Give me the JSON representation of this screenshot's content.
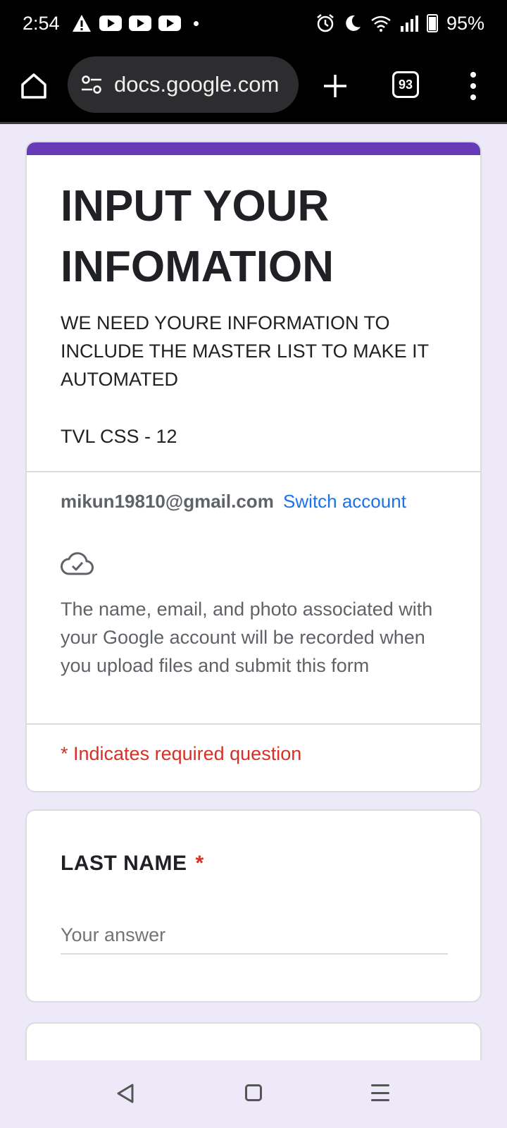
{
  "status_bar": {
    "time": "2:54",
    "battery": "95%"
  },
  "browser": {
    "url": "docs.google.com",
    "tab_count": "93"
  },
  "form": {
    "title": "INPUT YOUR INFOMATION",
    "description": "WE NEED YOURE INFORMATION TO INCLUDE THE MASTER LIST TO MAKE IT AUTOMATED",
    "section": "TVL CSS  - 12",
    "account_email": "mikun19810@gmail.com",
    "switch_account": "Switch account",
    "privacy_notice": "The name, email, and photo associated with your Google account will be recorded when you upload files and submit this form",
    "required_note": "* Indicates required question",
    "accent_color": "#673ab7"
  },
  "questions": [
    {
      "label": "LAST NAME",
      "required_mark": "*",
      "placeholder": "Your answer"
    }
  ],
  "icons": {
    "alert": "warning-icon",
    "youtube": "youtube-icon",
    "alarm": "alarm-icon",
    "dnd": "moon-icon",
    "wifi": "wifi-icon",
    "signal": "signal-icon",
    "cloud": "cloud-check-icon"
  }
}
